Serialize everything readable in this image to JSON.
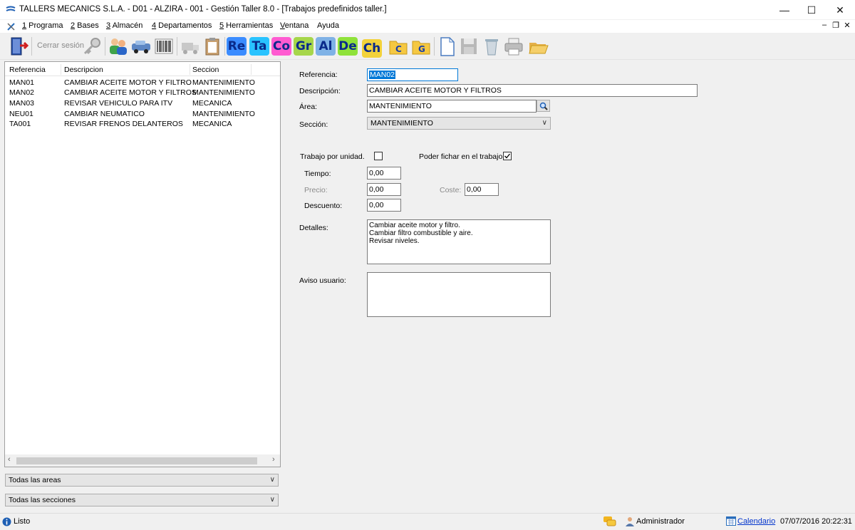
{
  "window": {
    "title": "TALLERS MECANICS S.L.A. - D01 - ALZIRA - 001 - Gestión Taller 8.0 - [Trabajos predefinidos taller.]"
  },
  "menu": {
    "items": [
      {
        "key": "1",
        "label": " Programa"
      },
      {
        "key": "2",
        "label": " Bases"
      },
      {
        "key": "3",
        "label": " Almacén"
      },
      {
        "key": "4",
        "label": " Departamentos"
      },
      {
        "key": "5",
        "label": " Herramientas"
      },
      {
        "key": "V",
        "label": "entana"
      },
      {
        "key": "",
        "label": "Ayuda"
      }
    ]
  },
  "toolbar": {
    "logout_label": "Cerrar sesión",
    "letter_buttons": [
      {
        "text": "Re",
        "bg": "#3b8cff"
      },
      {
        "text": "Ta",
        "bg": "#29c3ff"
      },
      {
        "text": "Co",
        "bg": "#ff5bd1"
      },
      {
        "text": "Gr",
        "bg": "#a6d64a"
      },
      {
        "text": "Al",
        "bg": "#7fb2e6"
      },
      {
        "text": "De",
        "bg": "#8fe23a"
      },
      {
        "text": "Ch",
        "bg": "#f3d23a"
      }
    ]
  },
  "list": {
    "columns": [
      "Referencia",
      "Descripcion",
      "Seccion"
    ],
    "rows": [
      {
        "ref": "MAN01",
        "desc": "CAMBIAR ACEITE MOTOR Y FILTRO",
        "sec": "MANTENIMIENTO"
      },
      {
        "ref": "MAN02",
        "desc": "CAMBIAR ACEITE MOTOR Y FILTROS",
        "sec": "MANTENIMIENTO"
      },
      {
        "ref": "MAN03",
        "desc": "REVISAR VEHICULO PARA ITV",
        "sec": "MECANICA"
      },
      {
        "ref": "NEU01",
        "desc": "CAMBIAR NEUMATICO",
        "sec": "MANTENIMIENTO"
      },
      {
        "ref": "TA001",
        "desc": "REVISAR FRENOS DELANTEROS",
        "sec": "MECANICA"
      }
    ],
    "filter_areas": "Todas las areas",
    "filter_sections": "Todas las secciones"
  },
  "form": {
    "referencia_label": "Referencia:",
    "referencia_value": "MAN02",
    "descripcion_label": "Descripción:",
    "descripcion_value": "CAMBIAR ACEITE MOTOR Y FILTROS",
    "area_label": "Área:",
    "area_value": "MANTENIMIENTO",
    "seccion_label": "Sección:",
    "seccion_value": "MANTENIMIENTO",
    "trabajo_unidad_label": "Trabajo por unidad.",
    "trabajo_unidad_checked": false,
    "fichar_label": "Poder fichar en el trabajo.",
    "fichar_checked": true,
    "tiempo_label": "Tiempo:",
    "tiempo_value": "0,00",
    "precio_label": "Precio:",
    "precio_value": "0,00",
    "coste_label": "Coste:",
    "coste_value": "0,00",
    "descuento_label": "Descuento:",
    "descuento_value": "0,00",
    "detalles_label": "Detalles:",
    "detalles_value": "Cambiar aceite motor y filtro.\nCambiar filtro combustible y aire.\nRevisar niveles.",
    "aviso_label": "Aviso usuario:",
    "aviso_value": ""
  },
  "status": {
    "text": "Listo",
    "user": "Administrador",
    "calendar": "Calendario",
    "datetime": "07/07/2016 20:22:31"
  }
}
